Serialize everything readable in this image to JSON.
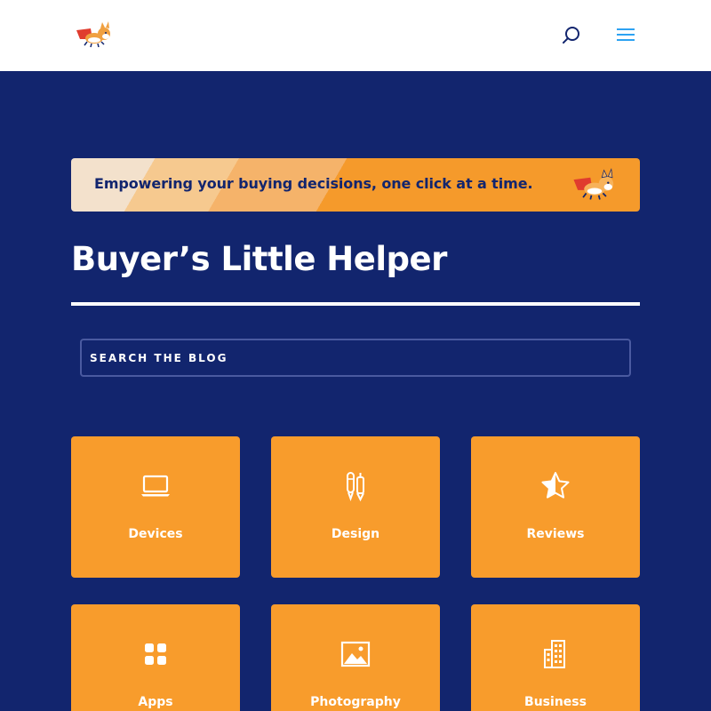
{
  "header": {
    "logo_icon": "corgi-superhero-logo",
    "search_icon": "search-icon",
    "menu_icon": "hamburger-menu-icon",
    "icon_color": "#2ea3f2"
  },
  "banner": {
    "tagline": "Empowering your buying decisions, one click at a time.",
    "logo_icon": "corgi-superhero-logo"
  },
  "page": {
    "title": "Buyer’s Little Helper"
  },
  "search": {
    "placeholder": "SEARCH THE BLOG"
  },
  "categories": [
    {
      "label": "Devices",
      "icon": "laptop-icon"
    },
    {
      "label": "Design",
      "icon": "pens-icon"
    },
    {
      "label": "Reviews",
      "icon": "half-star-icon"
    },
    {
      "label": "Apps",
      "icon": "apps-grid-icon"
    },
    {
      "label": "Photography",
      "icon": "image-icon"
    },
    {
      "label": "Business",
      "icon": "building-icon"
    }
  ],
  "colors": {
    "navy": "#12256e",
    "orange": "#f89c2c",
    "white": "#ffffff",
    "accent_blue": "#2ea3f2"
  }
}
